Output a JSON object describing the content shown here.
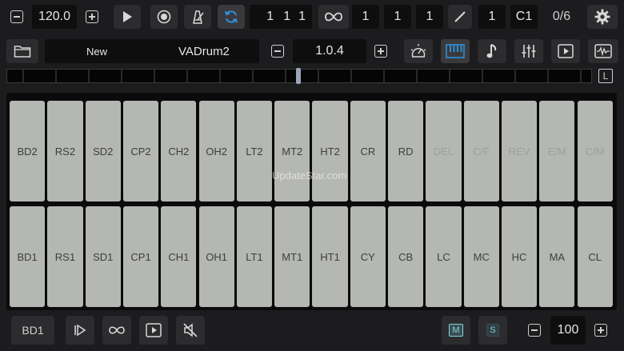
{
  "transport": {
    "tempo": "120.0",
    "position": [
      "1",
      "1",
      "1"
    ],
    "loop_values": [
      "1",
      "1",
      "1"
    ],
    "pencil_value": "1",
    "note": "C1",
    "counter": "0/6"
  },
  "preset": {
    "bank_label": "New",
    "name": "VADrum2",
    "version": "1.0.4"
  },
  "scroll": {
    "marker": "L"
  },
  "pads": {
    "top": [
      {
        "label": "BD2",
        "enabled": true
      },
      {
        "label": "RS2",
        "enabled": true
      },
      {
        "label": "SD2",
        "enabled": true
      },
      {
        "label": "CP2",
        "enabled": true
      },
      {
        "label": "CH2",
        "enabled": true
      },
      {
        "label": "OH2",
        "enabled": true
      },
      {
        "label": "LT2",
        "enabled": true
      },
      {
        "label": "MT2",
        "enabled": true
      },
      {
        "label": "HT2",
        "enabled": true
      },
      {
        "label": "CR",
        "enabled": true
      },
      {
        "label": "RD",
        "enabled": true
      },
      {
        "label": "DEL",
        "enabled": false
      },
      {
        "label": "C/F",
        "enabled": false
      },
      {
        "label": "REV",
        "enabled": false
      },
      {
        "label": "E/M",
        "enabled": false
      },
      {
        "label": "C/M",
        "enabled": false
      }
    ],
    "bottom": [
      {
        "label": "BD1",
        "enabled": true
      },
      {
        "label": "RS1",
        "enabled": true
      },
      {
        "label": "SD1",
        "enabled": true
      },
      {
        "label": "CP1",
        "enabled": true
      },
      {
        "label": "CH1",
        "enabled": true
      },
      {
        "label": "OH1",
        "enabled": true
      },
      {
        "label": "LT1",
        "enabled": true
      },
      {
        "label": "MT1",
        "enabled": true
      },
      {
        "label": "HT1",
        "enabled": true
      },
      {
        "label": "CY",
        "enabled": true
      },
      {
        "label": "CB",
        "enabled": true
      },
      {
        "label": "LC",
        "enabled": true
      },
      {
        "label": "MC",
        "enabled": true
      },
      {
        "label": "HC",
        "enabled": true
      },
      {
        "label": "MA",
        "enabled": true
      },
      {
        "label": "CL",
        "enabled": true
      }
    ]
  },
  "watermark": "UpdateStar.com",
  "bottom": {
    "selected_pad": "BD1",
    "mute_label": "M",
    "solo_label": "S",
    "velocity": "100"
  },
  "colors": {
    "accent": "#2f8fd8",
    "pad": "#b5b7b2",
    "toggle_active": "#3a4e52",
    "toggle_text": "#7fd4d8"
  }
}
